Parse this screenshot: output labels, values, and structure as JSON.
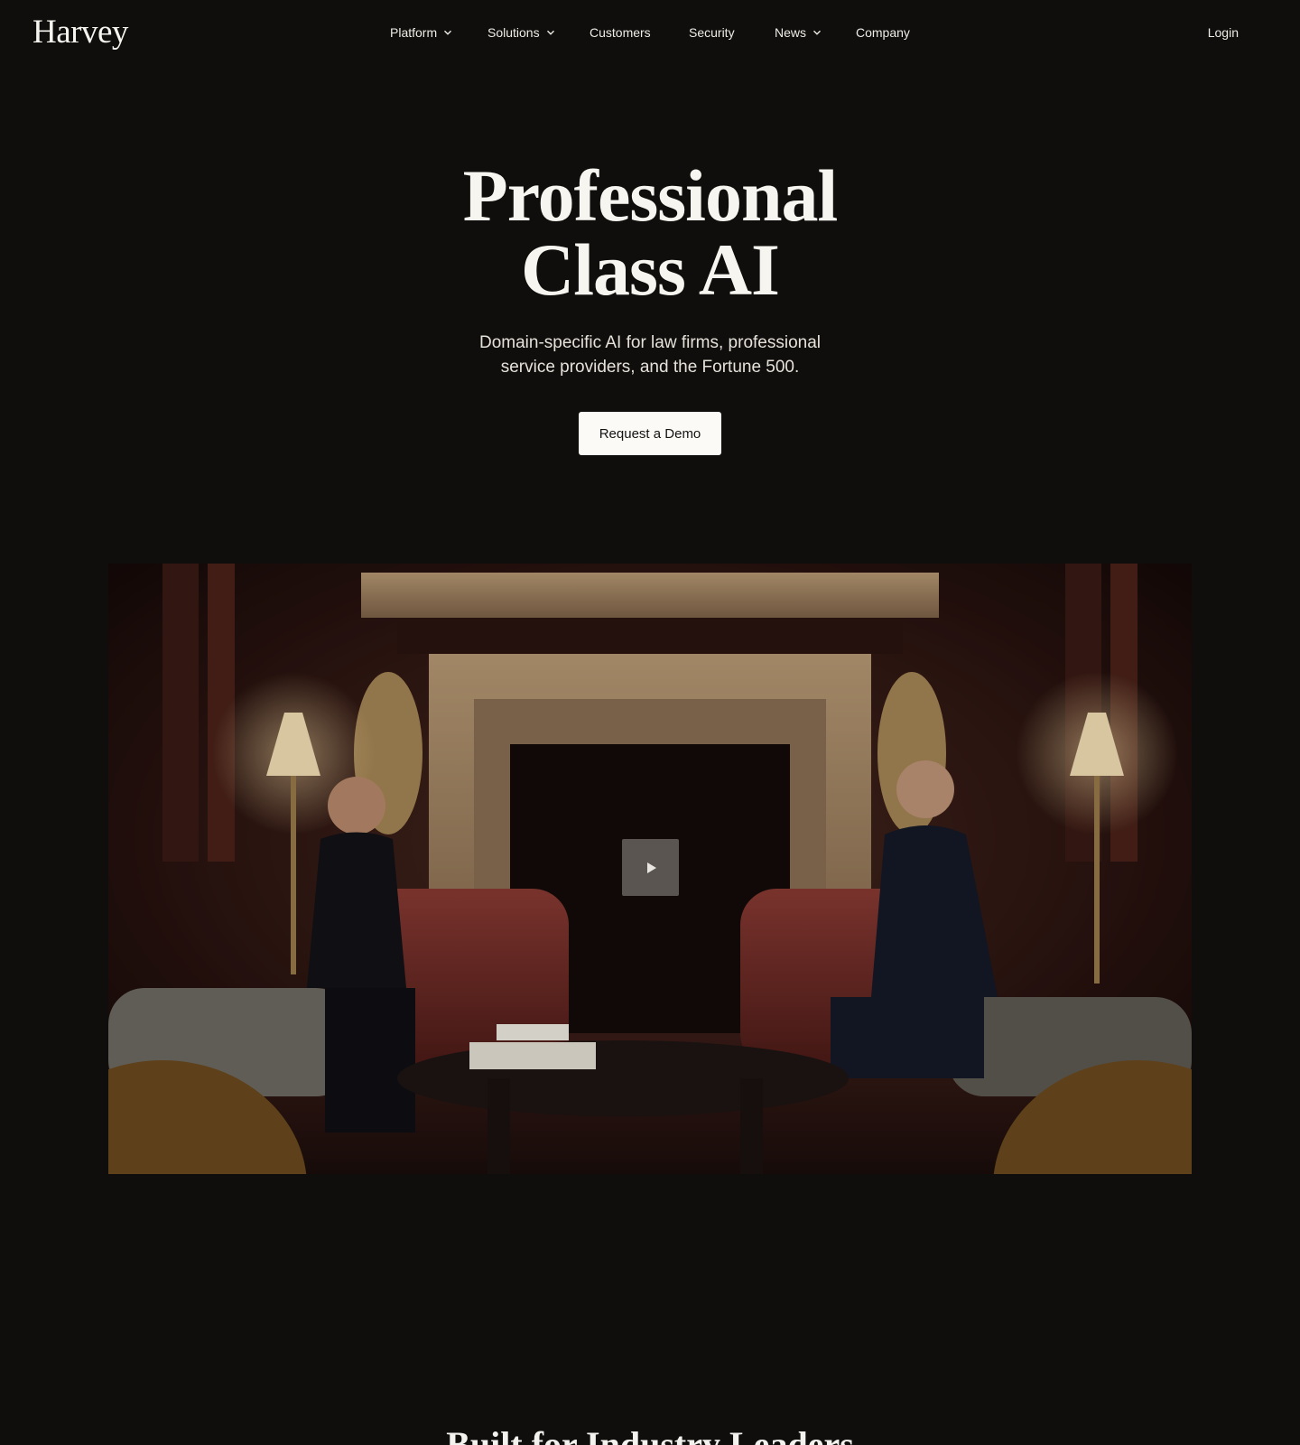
{
  "brand": {
    "name": "Harvey"
  },
  "nav": {
    "items": [
      {
        "label": "Platform",
        "has_dropdown": true
      },
      {
        "label": "Solutions",
        "has_dropdown": true
      },
      {
        "label": "Customers",
        "has_dropdown": false
      },
      {
        "label": "Security",
        "has_dropdown": false
      },
      {
        "label": "News",
        "has_dropdown": true
      },
      {
        "label": "Company",
        "has_dropdown": false
      }
    ],
    "login_label": "Login"
  },
  "hero": {
    "title_line1": "Professional",
    "title_line2": "Class AI",
    "subtitle_line1": "Domain-specific AI for law firms, professional",
    "subtitle_line2": "service providers, and the Fortune 500.",
    "cta_label": "Request a Demo"
  },
  "video": {
    "play_icon": "play-icon"
  },
  "section": {
    "heading": "Built for Industry Leaders"
  },
  "colors": {
    "background": "#0f0e0d",
    "text": "#f4f2ee",
    "cta_bg": "#fbfaf7",
    "cta_text": "#141312"
  }
}
